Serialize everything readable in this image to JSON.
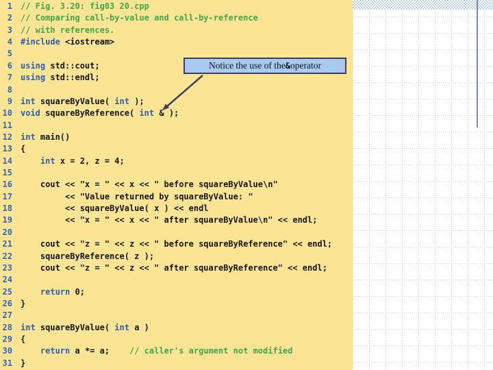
{
  "slide": {
    "type": "code-listing-slide",
    "figure": "Fig. 3.20: fig03 20.cpp"
  },
  "colors": {
    "code_background": "#FBE494",
    "keyword": "#2B5FA9",
    "comment": "#3DA848",
    "plain_code": "#141414",
    "line_number": "#3465AE",
    "callout_fill": "#A9C9F1",
    "callout_border": "#3E3E5C",
    "arrow": "#3E3E5C",
    "grid_dot": "#C7CEDD",
    "checker_band": "#BDD0EA",
    "vertical_rule": "#7486BB"
  },
  "callout": {
    "segments": [
      {
        "t": "Notice the use of the "
      },
      {
        "t": "&",
        "amp": true
      },
      {
        "t": " operator"
      }
    ]
  },
  "code": {
    "lines": [
      {
        "n": 1,
        "seg": [
          [
            "c",
            "// Fig. 3.20: fig03 20.cpp"
          ]
        ]
      },
      {
        "n": 2,
        "seg": [
          [
            "c",
            "// Comparing call-by-value and call-by-reference"
          ]
        ]
      },
      {
        "n": 3,
        "seg": [
          [
            "c",
            "// with references."
          ]
        ]
      },
      {
        "n": 4,
        "seg": [
          [
            "k",
            "#include"
          ],
          [
            "t",
            " <iostream>"
          ]
        ]
      },
      {
        "n": 5,
        "seg": []
      },
      {
        "n": 6,
        "seg": [
          [
            "k",
            "using"
          ],
          [
            "t",
            " std::cout;"
          ]
        ]
      },
      {
        "n": 7,
        "seg": [
          [
            "k",
            "using"
          ],
          [
            "t",
            " std::endl;"
          ]
        ]
      },
      {
        "n": 8,
        "seg": []
      },
      {
        "n": 9,
        "seg": [
          [
            "k",
            "int"
          ],
          [
            "t",
            " squareByValue( "
          ],
          [
            "k",
            "int"
          ],
          [
            "t",
            " );"
          ]
        ]
      },
      {
        "n": 10,
        "seg": [
          [
            "k",
            "void"
          ],
          [
            "t",
            " squareByReference( "
          ],
          [
            "k",
            "int"
          ],
          [
            "t",
            " & );"
          ]
        ]
      },
      {
        "n": 11,
        "seg": []
      },
      {
        "n": 12,
        "seg": [
          [
            "k",
            "int"
          ],
          [
            "t",
            " main()"
          ]
        ]
      },
      {
        "n": 13,
        "seg": [
          [
            "t",
            "{"
          ]
        ]
      },
      {
        "n": 14,
        "seg": [
          [
            "t",
            "    "
          ],
          [
            "k",
            "int"
          ],
          [
            "t",
            " x = 2, z = 4;"
          ]
        ]
      },
      {
        "n": 15,
        "seg": []
      },
      {
        "n": 16,
        "seg": [
          [
            "t",
            "    cout << \"x = \" << x << \" before squareByValue\\n\""
          ]
        ]
      },
      {
        "n": 17,
        "seg": [
          [
            "t",
            "         << \"Value returned by squareByValue: \""
          ]
        ]
      },
      {
        "n": 18,
        "seg": [
          [
            "t",
            "         << squareByValue( x ) << endl"
          ]
        ]
      },
      {
        "n": 19,
        "seg": [
          [
            "t",
            "         << \"x = \" << x << \" after squareByValue\\n\" << endl;"
          ]
        ]
      },
      {
        "n": 20,
        "seg": []
      },
      {
        "n": 21,
        "seg": [
          [
            "t",
            "    cout << \"z = \" << z << \" before squareByReference\" << endl;"
          ]
        ]
      },
      {
        "n": 22,
        "seg": [
          [
            "t",
            "    squareByReference( z );"
          ]
        ]
      },
      {
        "n": 23,
        "seg": [
          [
            "t",
            "    cout << \"z = \" << z << \" after squareByReference\" << endl;"
          ]
        ]
      },
      {
        "n": 24,
        "seg": []
      },
      {
        "n": 25,
        "seg": [
          [
            "t",
            "    "
          ],
          [
            "k",
            "return"
          ],
          [
            "t",
            " 0;"
          ]
        ]
      },
      {
        "n": 26,
        "seg": [
          [
            "t",
            "}"
          ]
        ]
      },
      {
        "n": 27,
        "seg": []
      },
      {
        "n": 28,
        "seg": [
          [
            "k",
            "int"
          ],
          [
            "t",
            " squareByValue( "
          ],
          [
            "k",
            "int"
          ],
          [
            "t",
            " a )"
          ]
        ]
      },
      {
        "n": 29,
        "seg": [
          [
            "t",
            "{"
          ]
        ]
      },
      {
        "n": 30,
        "seg": [
          [
            "t",
            "    "
          ],
          [
            "k",
            "return"
          ],
          [
            "t",
            " a *= a;    "
          ],
          [
            "c",
            "// caller's argument not modified"
          ]
        ]
      },
      {
        "n": 31,
        "seg": [
          [
            "t",
            "}"
          ]
        ]
      }
    ]
  }
}
